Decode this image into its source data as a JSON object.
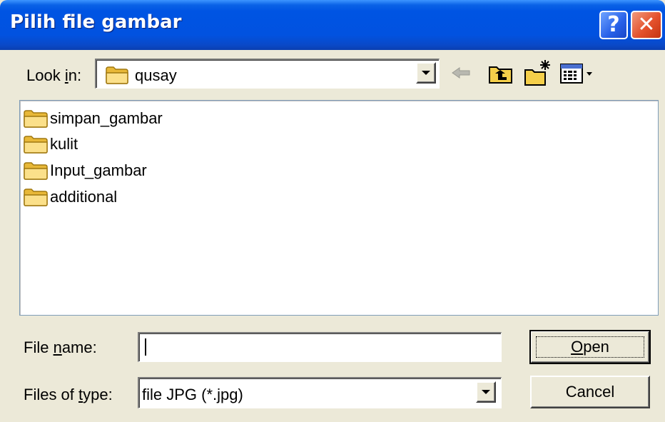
{
  "window": {
    "title": "Pilih file gambar",
    "help_label": "?",
    "close_label": "✕",
    "colors": {
      "titlebar": "#0054e3",
      "dialog_bg": "#ece9d8",
      "close": "#e4512c"
    }
  },
  "look_in": {
    "label_pre": "Look ",
    "label_accel": "i",
    "label_post": "n:",
    "value": "qusay"
  },
  "toolbar": {
    "back": "back-arrow-icon",
    "up": "up-one-level-icon",
    "new_folder": "create-new-folder-icon",
    "views": "view-menu-icon"
  },
  "files": [
    {
      "name": "simpan_gambar",
      "icon": "folder-icon"
    },
    {
      "name": "kulit",
      "icon": "folder-icon"
    },
    {
      "name": "Input_gambar",
      "icon": "folder-icon"
    },
    {
      "name": "additional",
      "icon": "folder-icon"
    }
  ],
  "file_name": {
    "label_pre": "File ",
    "label_accel": "n",
    "label_post": "ame:",
    "value": ""
  },
  "file_type": {
    "label_pre": "Files of ",
    "label_accel": "t",
    "label_post": "ype:",
    "value": "file JPG (*.jpg)"
  },
  "buttons": {
    "open_accel": "O",
    "open_rest": "pen",
    "cancel": "Cancel"
  }
}
